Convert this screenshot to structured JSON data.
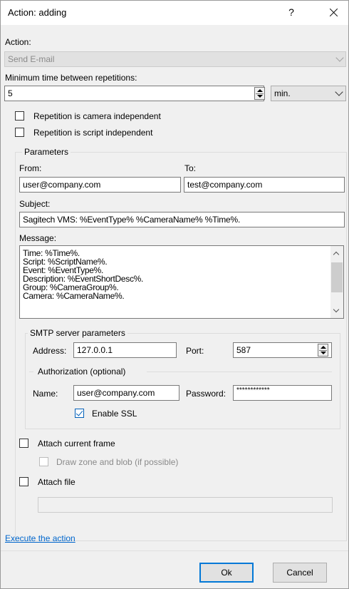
{
  "window": {
    "title": "Action: adding",
    "help_label": "?"
  },
  "action": {
    "label": "Action:",
    "selected": "Send E-mail"
  },
  "repetition": {
    "label": "Minimum time between repetitions:",
    "value": "5",
    "unit": "min."
  },
  "checks": {
    "camera_independent": "Repetition is camera independent",
    "script_independent": "Repetition is script independent"
  },
  "parameters": {
    "title": "Parameters",
    "from_label": "From:",
    "from_value": "user@company.com",
    "to_label": "To:",
    "to_value": "test@company.com",
    "subject_label": "Subject:",
    "subject_value": "Sagitech VMS: %EventType% %CameraName% %Time%.",
    "message_label": "Message:",
    "message_lines": [
      "Time: %Time%.",
      "Script: %ScriptName%.",
      "Event: %EventType%.",
      "Description: %EventShortDesc%.",
      "Group: %CameraGroup%.",
      "Camera: %CameraName%."
    ]
  },
  "smtp": {
    "title": "SMTP server parameters",
    "address_label": "Address:",
    "address_value": "127.0.0.1",
    "port_label": "Port:",
    "port_value": "587",
    "auth_title": "Authorization (optional)",
    "name_label": "Name:",
    "name_value": "user@company.com",
    "password_label": "Password:",
    "password_value": "************",
    "ssl_label": "Enable SSL",
    "ssl_checked": true
  },
  "attach": {
    "frame_label": "Attach current frame",
    "zone_label": "Draw zone and blob (if possible)",
    "file_label": "Attach file",
    "file_value": ""
  },
  "footer": {
    "execute_link": "Execute the action",
    "ok": "Ok",
    "cancel": "Cancel"
  },
  "colors": {
    "link": "#0066cc",
    "accent": "#0078d7",
    "window_bg": "#f0f0f0"
  }
}
